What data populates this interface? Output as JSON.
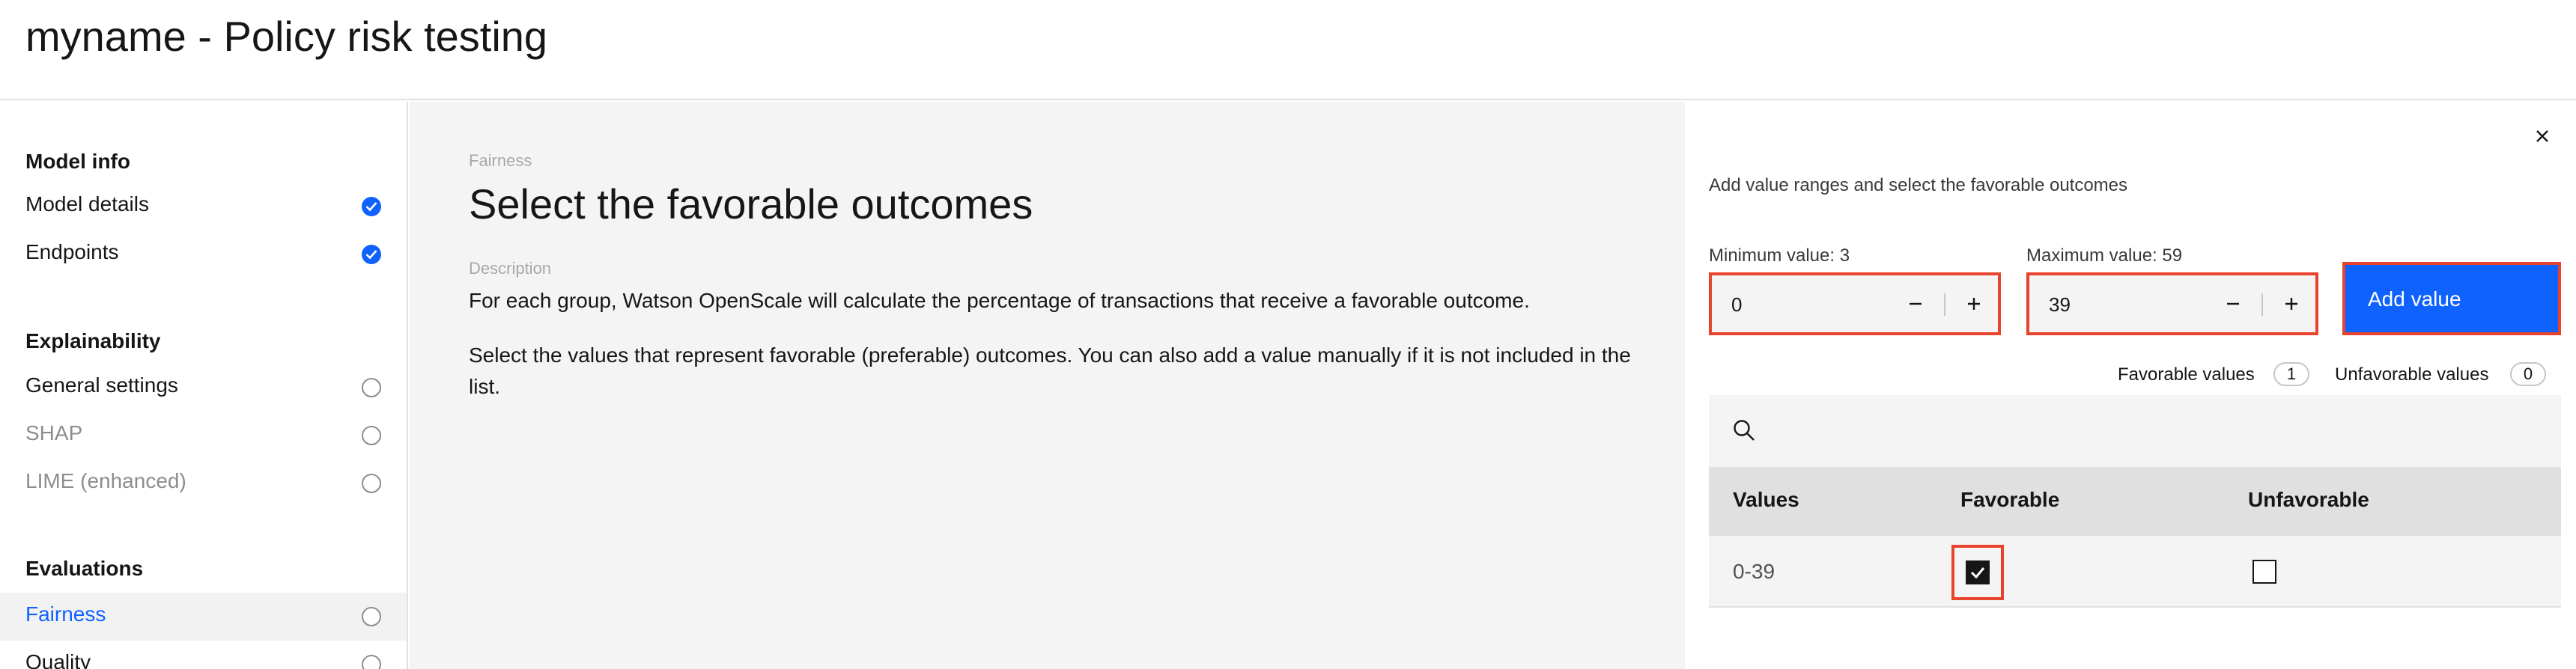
{
  "header": {
    "title": "myname - Policy risk testing"
  },
  "sidebar": {
    "sections": [
      {
        "title": "Model info",
        "items": [
          {
            "label": "Model details",
            "status": "done"
          },
          {
            "label": "Endpoints",
            "status": "done"
          }
        ]
      },
      {
        "title": "Explainability",
        "items": [
          {
            "label": "General settings",
            "status": "todo"
          },
          {
            "label": "SHAP",
            "status": "todo",
            "disabled": true
          },
          {
            "label": "LIME (enhanced)",
            "status": "todo",
            "disabled": true
          }
        ]
      },
      {
        "title": "Evaluations",
        "items": [
          {
            "label": "Fairness",
            "status": "todo",
            "active": true
          },
          {
            "label": "Quality",
            "status": "todo"
          }
        ]
      }
    ]
  },
  "main": {
    "eyebrow": "Fairness",
    "title": "Select the favorable outcomes",
    "description_label": "Description",
    "description_1": "For each group, Watson OpenScale will calculate the percentage of transactions that receive a favorable outcome.",
    "description_2": "Select the values that represent favorable (preferable) outcomes. You can also add a value manually if it is not included in the list."
  },
  "panel": {
    "intro": "Add value ranges and select the favorable outcomes",
    "min_label": "Minimum value: 3",
    "max_label": "Maximum value: 59",
    "min_value": "0",
    "max_value": "39",
    "add_button": "Add value",
    "favorable_label": "Favorable values",
    "favorable_count": "1",
    "unfavorable_label": "Unfavorable values",
    "unfavorable_count": "0",
    "table": {
      "headers": [
        "Values",
        "Favorable",
        "Unfavorable"
      ],
      "rows": [
        {
          "value": "0-39",
          "favorable": true,
          "unfavorable": false
        }
      ]
    }
  },
  "colors": {
    "accent": "#0f62fe",
    "highlight": "#e8432d",
    "panel_bg": "#f4f4f4"
  },
  "icons": [
    "check-icon",
    "circle-icon",
    "close-icon",
    "minus-icon",
    "plus-icon",
    "search-icon"
  ]
}
